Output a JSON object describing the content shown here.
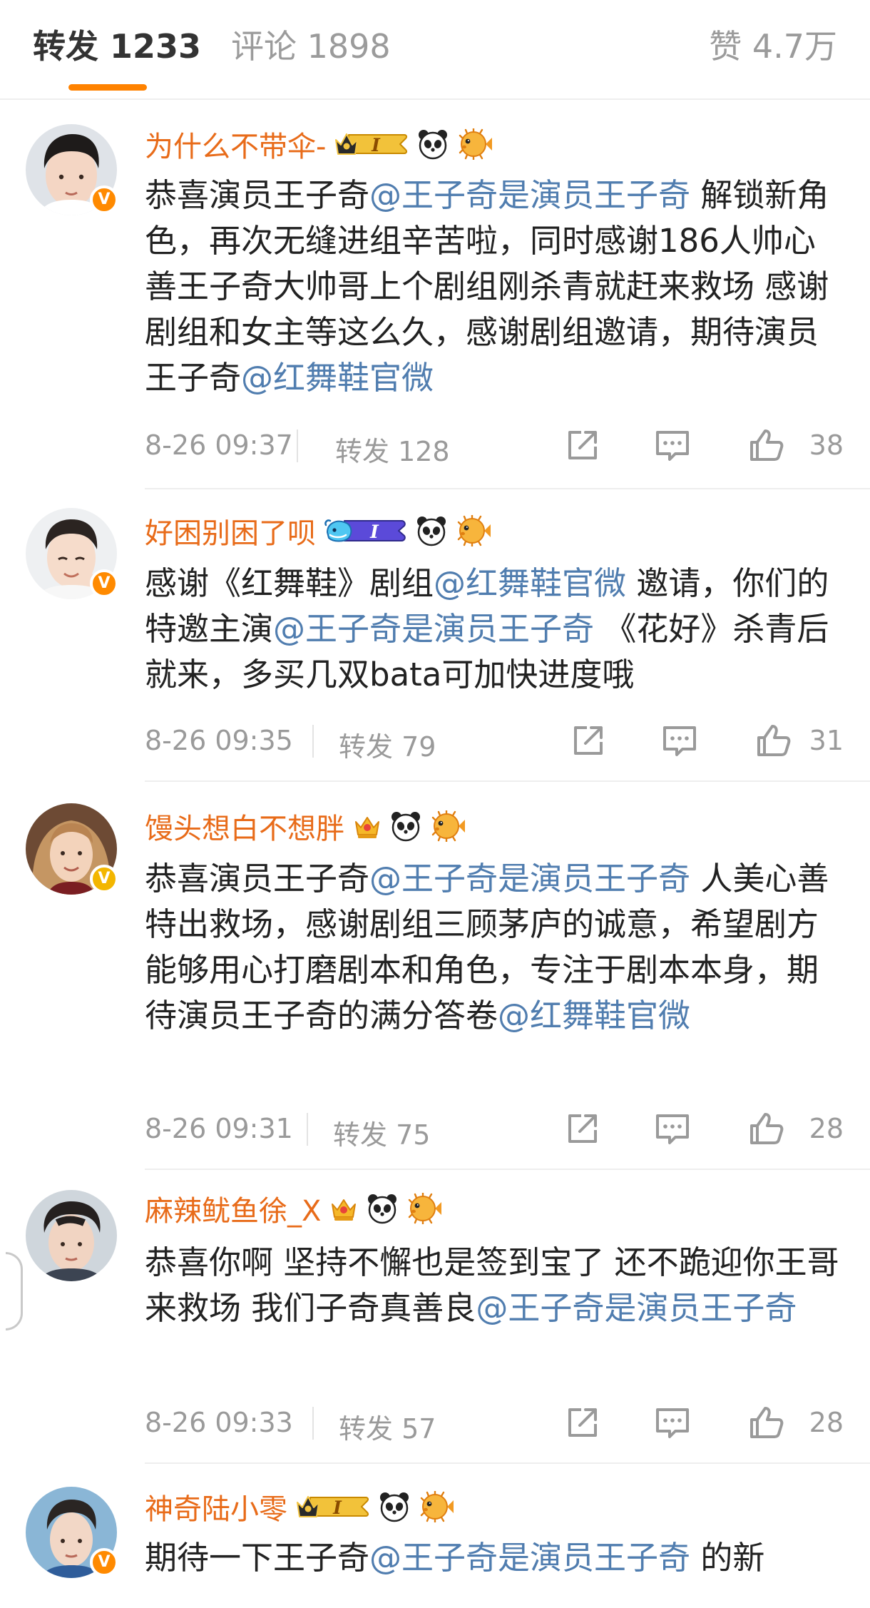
{
  "tabs": {
    "reposts_label": "转发 1233",
    "comments_label": "评论 1898",
    "likes_label": "赞 4.7万"
  },
  "colors": {
    "accent": "#ff8200",
    "username": "#e86b19",
    "mention": "#507daf",
    "meta": "#9a9a9a"
  },
  "comments": [
    {
      "username": "为什么不带伞-",
      "badges": [
        "crown-level-badge",
        "panda-icon",
        "pufferfish-icon"
      ],
      "text_parts": [
        {
          "t": "恭喜演员王子奇",
          "m": false
        },
        {
          "t": "@王子奇是演员王子奇",
          "m": true
        },
        {
          "t": " 解锁新角色，再次无缝进组辛苦啦，同时感谢186人帅心善王子奇大帅哥上个剧组刚杀青就赶来救场 感谢剧组和女主等这么久，感谢剧组邀请，期待演员王子奇",
          "m": false
        },
        {
          "t": "@红舞鞋官微",
          "m": true
        }
      ],
      "time": "8-26 09:37",
      "repost": "转发 128",
      "likes": "38"
    },
    {
      "username": "好困别困了呗",
      "badges": [
        "whale-level-badge",
        "panda-icon",
        "pufferfish-icon"
      ],
      "text_parts": [
        {
          "t": "感谢《红舞鞋》剧组",
          "m": false
        },
        {
          "t": "@红舞鞋官微",
          "m": true
        },
        {
          "t": " 邀请，你们的特邀主演",
          "m": false
        },
        {
          "t": "@王子奇是演员王子奇",
          "m": true
        },
        {
          "t": " 《花好》杀青后就来，多买几双bata可加快进度哦",
          "m": false
        }
      ],
      "time": "8-26 09:35",
      "repost": "转发 79",
      "likes": "31"
    },
    {
      "username": "馒头想白不想胖",
      "badges": [
        "crown-icon",
        "panda-icon",
        "pufferfish-icon"
      ],
      "text_parts": [
        {
          "t": "恭喜演员王子奇",
          "m": false
        },
        {
          "t": "@王子奇是演员王子奇",
          "m": true
        },
        {
          "t": " 人美心善特出救场，感谢剧组三顾茅庐的诚意，希望剧方能够用心打磨剧本和角色，专注于剧本本身，期待演员王子奇的满分答卷",
          "m": false
        },
        {
          "t": "@红舞鞋官微",
          "m": true
        }
      ],
      "time": "8-26 09:31",
      "repost": "转发 75",
      "likes": "28"
    },
    {
      "username": "麻辣鱿鱼徐_X",
      "badges": [
        "crown-icon",
        "panda-icon",
        "pufferfish-icon"
      ],
      "text_parts": [
        {
          "t": "恭喜你啊 坚持不懈也是签到宝了 还不跪迎你王哥来救场 我们子奇真善良",
          "m": false
        },
        {
          "t": "@王子奇是演员王子奇",
          "m": true
        }
      ],
      "time": "8-26 09:33",
      "repost": "转发 57",
      "likes": "28"
    },
    {
      "username": "神奇陆小零",
      "badges": [
        "crown-level-badge",
        "panda-icon",
        "pufferfish-icon"
      ],
      "text_parts": [
        {
          "t": "期待一下王子奇",
          "m": false
        },
        {
          "t": "@王子奇是演员王子奇",
          "m": true
        },
        {
          "t": " 的新",
          "m": false
        }
      ],
      "time": "",
      "repost": "",
      "likes": ""
    }
  ]
}
